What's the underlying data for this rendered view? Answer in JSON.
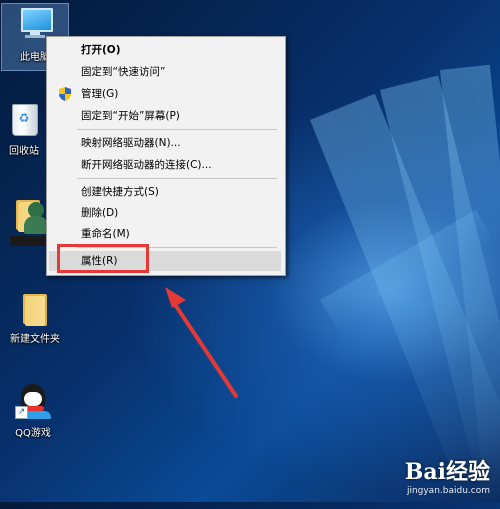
{
  "desktop": {
    "icons": [
      {
        "label": "此电脑",
        "icon": "computer-icon"
      },
      {
        "label": "回收站",
        "icon": "recycle-bin-icon"
      },
      {
        "label": "",
        "icon": "user-folder-icon"
      },
      {
        "label": "新建文件夹",
        "icon": "folder-icon"
      },
      {
        "label": "QQ游戏",
        "icon": "qq-game-icon"
      }
    ]
  },
  "context_menu": {
    "items": [
      {
        "label": "打开(O)",
        "bold": true
      },
      {
        "label": "固定到“快速访问”"
      },
      {
        "label": "管理(G)",
        "icon": "uac-shield-icon"
      },
      {
        "label": "固定到“开始”屏幕(P)"
      },
      {
        "label": "映射网络驱动器(N)..."
      },
      {
        "label": "断开网络驱动器的连接(C)..."
      },
      {
        "label": "创建快捷方式(S)"
      },
      {
        "label": "删除(D)"
      },
      {
        "label": "重命名(M)"
      },
      {
        "label": "属性(R)",
        "highlighted": true
      }
    ]
  },
  "annotation": {
    "highlight_color": "#e53935",
    "arrow_color": "#e53935"
  },
  "watermark": {
    "logo": "Bai经验",
    "url": "jingyan.baidu.com"
  }
}
